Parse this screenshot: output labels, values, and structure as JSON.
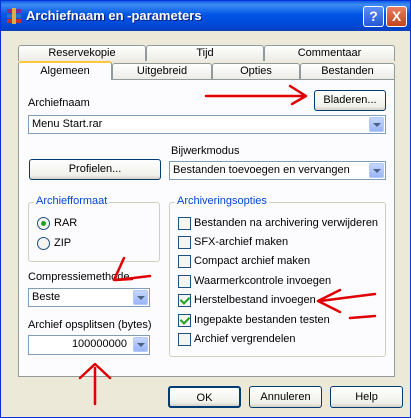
{
  "window": {
    "title": "Archiefnaam en -parameters"
  },
  "titlebar_buttons": {
    "help": "?",
    "close": "X"
  },
  "tabs_back": [
    "Reservekopie",
    "Tijd",
    "Commentaar"
  ],
  "tabs_front": [
    "Algemeen",
    "Uitgebreid",
    "Opties",
    "Bestanden"
  ],
  "archive_name": {
    "label": "Archiefnaam",
    "value": "Menu Start.rar",
    "browse_button": "Bladeren..."
  },
  "profiles_button": "Profielen...",
  "update_mode": {
    "label": "Bijwerkmodus",
    "value": "Bestanden toevoegen en vervangen"
  },
  "archive_format": {
    "title": "Archiefformaat",
    "options": [
      {
        "label": "RAR",
        "selected": true
      },
      {
        "label": "ZIP",
        "selected": false
      }
    ]
  },
  "compression": {
    "label": "Compressiemethode",
    "value": "Beste"
  },
  "split": {
    "label": "Archief opsplitsen (bytes)",
    "value": "100000000"
  },
  "archiving_options": {
    "title": "Archiveringsopties",
    "items": [
      {
        "label": "Bestanden na archivering verwijderen",
        "checked": false
      },
      {
        "label": "SFX-archief maken",
        "checked": false
      },
      {
        "label": "Compact archief maken",
        "checked": false
      },
      {
        "label": "Waarmerkcontrole invoegen",
        "checked": false
      },
      {
        "label": "Herstelbestand invoegen",
        "checked": true
      },
      {
        "label": "Ingepakte bestanden testen",
        "checked": true
      },
      {
        "label": "Archief vergrendelen",
        "checked": false
      }
    ]
  },
  "footer": {
    "ok": "OK",
    "cancel": "Annuleren",
    "help": "Help"
  },
  "annotation_color": "#e00000"
}
